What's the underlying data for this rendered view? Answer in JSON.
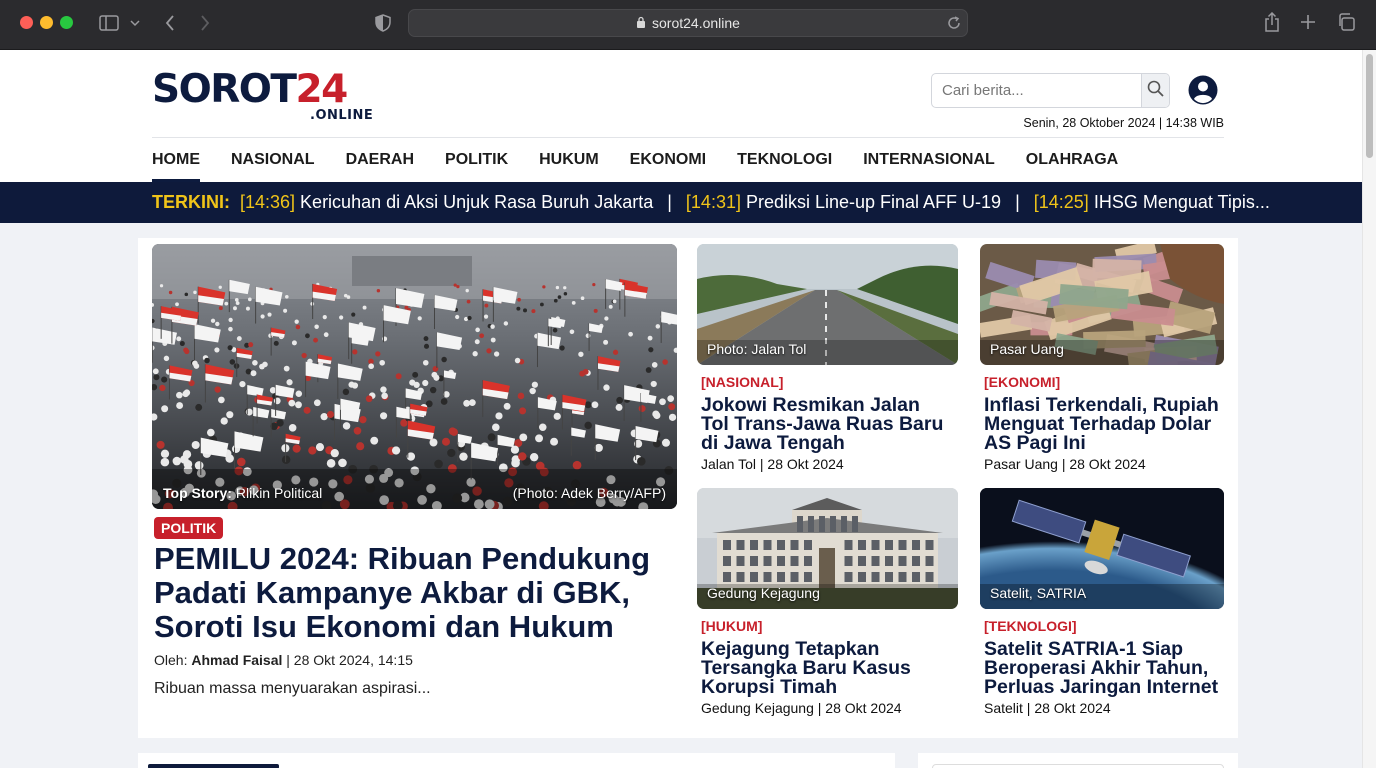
{
  "browser": {
    "url": "sorot24.online"
  },
  "site": {
    "logo_main": "SOROT",
    "logo_number": "24",
    "logo_sub": ".ONLINE",
    "search_placeholder": "Cari berita...",
    "datetime": "Senin, 28 Oktober 2024 | 14:38 WIB"
  },
  "nav": [
    {
      "label": "HOME",
      "active": true
    },
    {
      "label": "NASIONAL"
    },
    {
      "label": "DAERAH"
    },
    {
      "label": "POLITIK"
    },
    {
      "label": "HUKUM"
    },
    {
      "label": "EKONOMI"
    },
    {
      "label": "TEKNOLOGI"
    },
    {
      "label": "INTERNASIONAL"
    },
    {
      "label": "OLAHRAGA"
    }
  ],
  "ticker": {
    "label": "TERKINI:",
    "items": [
      {
        "time": "[14:36]",
        "text": "Kericuhan di Aksi Unjuk Rasa Buruh Jakarta"
      },
      {
        "time": "[14:31]",
        "text": "Prediksi Line-up Final AFF U-19"
      },
      {
        "time": "[14:25]",
        "text": "IHSG Menguat Tipis..."
      }
    ],
    "separator": "|"
  },
  "hero": {
    "caption_label": "Top Story:",
    "caption_text": "Rlikin Political",
    "photo_credit": "(Photo: Adek Berry/AFP)",
    "category": "POLITIK",
    "title": "PEMILU 2024: Ribuan Pendukung Padati Kampanye Akbar di GBK, Soroti Isu Ekonomi dan Hukum",
    "byline_prefix": "Oleh:",
    "author": "Ahmad Faisal",
    "byline_date": "| 28 Okt 2024, 14:15",
    "excerpt": "Ribuan massa menyuarakan aspirasi..."
  },
  "cards": [
    {
      "caption": "Photo: Jalan Tol",
      "category": "[NASIONAL]",
      "title": "Jokowi Resmikan Jalan Tol Trans-Jawa Ruas Baru di Jawa Tengah",
      "meta": "Jalan Tol | 28 Okt 2024"
    },
    {
      "caption": "Pasar Uang",
      "category": "[EKONOMI]",
      "title": "Inflasi Terkendali, Rupiah Menguat Terhadap Dolar AS Pagi Ini",
      "meta": "Pasar Uang | 28 Okt 2024"
    },
    {
      "caption": "Gedung Kejagung",
      "category": "[HUKUM]",
      "title": "Kejagung Tetapkan Tersangka Baru Kasus Korupsi Timah",
      "meta": "Gedung Kejagung | 28 Okt 2024"
    },
    {
      "caption": "Satelit, SATRIA",
      "category": "[TEKNOLOGI]",
      "title": "Satelit SATRIA-1 Siap Beroperasi Akhir Tahun, Perluas Jaringan Internet",
      "meta": "Satelit | 28 Okt 2024"
    }
  ],
  "colors": {
    "brand_navy": "#0d1b3e",
    "brand_red": "#c7202b",
    "ticker_time": "#f0c419"
  }
}
